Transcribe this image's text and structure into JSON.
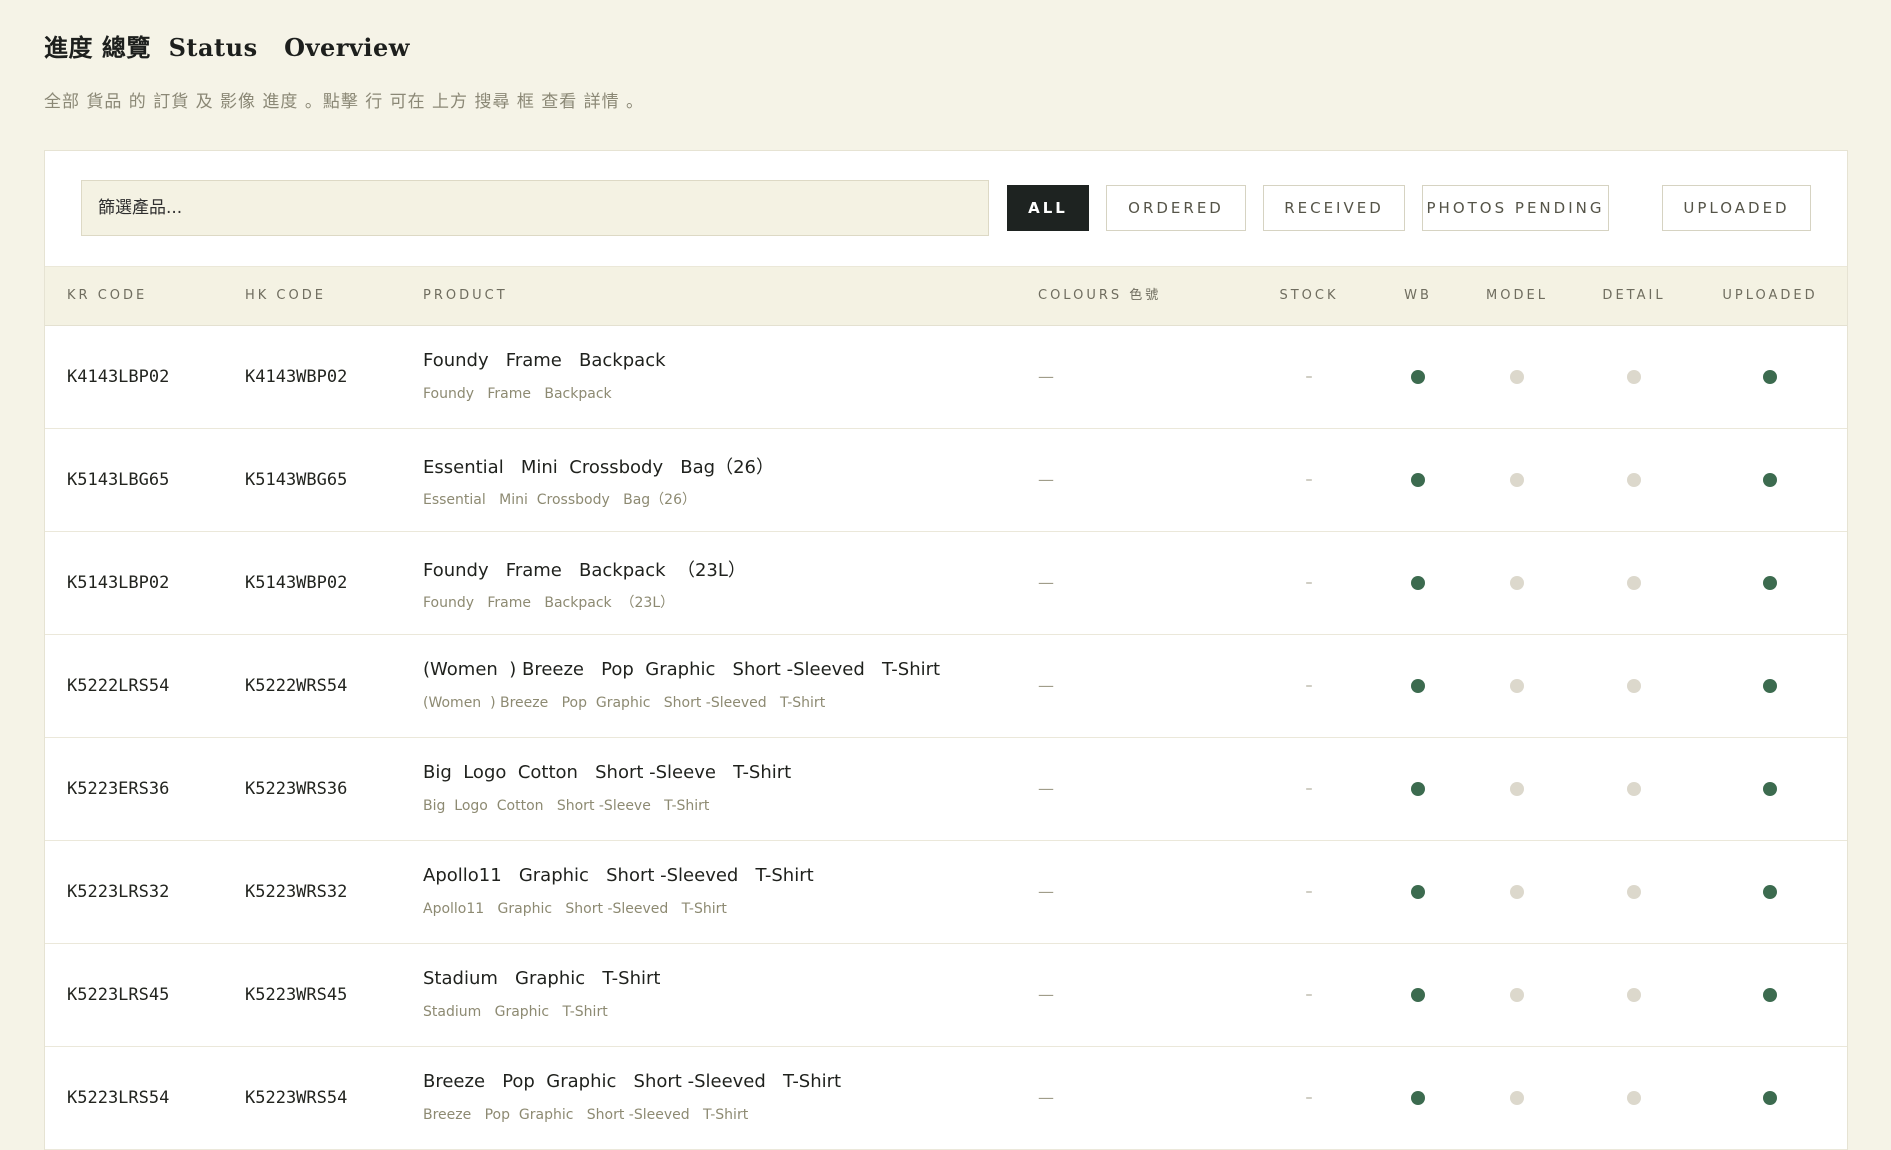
{
  "header": {
    "title": "進度 總覽  Status   Overview",
    "subtitle": "全部 貨品 的 訂貨 及 影像 進度 。點擊 行 可在 上方 搜尋 框 查看 詳情 。"
  },
  "toolbar": {
    "search_placeholder": "篩選產品...",
    "filters": [
      {
        "label": "ALL",
        "active": true
      },
      {
        "label": "ORDERED",
        "active": false
      },
      {
        "label": "RECEIVED",
        "active": false
      },
      {
        "label": "PHOTOS PENDING",
        "active": false
      },
      {
        "label": "UPLOADED",
        "active": false
      }
    ]
  },
  "table": {
    "columns": [
      "KR CODE",
      "HK CODE",
      "PRODUCT",
      "COLOURS 色號",
      "STOCK",
      "WB",
      "MODEL",
      "DETAIL",
      "UPLOADED"
    ],
    "rows": [
      {
        "kr": "K4143LBP02",
        "hk": "K4143WBP02",
        "name": "Foundy   Frame   Backpack",
        "sub": "Foundy   Frame   Backpack",
        "colours": "—",
        "stock": "–",
        "wb": true,
        "model": false,
        "detail": false,
        "uploaded": true
      },
      {
        "kr": "K5143LBG65",
        "hk": "K5143WBG65",
        "name": "Essential   Mini  Crossbody   Bag（26）",
        "sub": "Essential   Mini  Crossbody   Bag（26）",
        "colours": "—",
        "stock": "–",
        "wb": true,
        "model": false,
        "detail": false,
        "uploaded": true
      },
      {
        "kr": "K5143LBP02",
        "hk": "K5143WBP02",
        "name": "Foundy   Frame   Backpack  （23L）",
        "sub": "Foundy   Frame   Backpack  （23L）",
        "colours": "—",
        "stock": "–",
        "wb": true,
        "model": false,
        "detail": false,
        "uploaded": true
      },
      {
        "kr": "K5222LRS54",
        "hk": "K5222WRS54",
        "name": "(Women  ) Breeze   Pop  Graphic   Short -Sleeved   T-Shirt",
        "sub": "(Women  ) Breeze   Pop  Graphic   Short -Sleeved   T-Shirt",
        "colours": "—",
        "stock": "–",
        "wb": true,
        "model": false,
        "detail": false,
        "uploaded": true
      },
      {
        "kr": "K5223ERS36",
        "hk": "K5223WRS36",
        "name": "Big  Logo  Cotton   Short -Sleeve   T-Shirt",
        "sub": "Big  Logo  Cotton   Short -Sleeve   T-Shirt",
        "colours": "—",
        "stock": "–",
        "wb": true,
        "model": false,
        "detail": false,
        "uploaded": true
      },
      {
        "kr": "K5223LRS32",
        "hk": "K5223WRS32",
        "name": "Apollo11   Graphic   Short -Sleeved   T-Shirt",
        "sub": "Apollo11   Graphic   Short -Sleeved   T-Shirt",
        "colours": "—",
        "stock": "–",
        "wb": true,
        "model": false,
        "detail": false,
        "uploaded": true
      },
      {
        "kr": "K5223LRS45",
        "hk": "K5223WRS45",
        "name": "Stadium   Graphic   T-Shirt",
        "sub": "Stadium   Graphic   T-Shirt",
        "colours": "—",
        "stock": "–",
        "wb": true,
        "model": false,
        "detail": false,
        "uploaded": true
      },
      {
        "kr": "K5223LRS54",
        "hk": "K5223WRS54",
        "name": "Breeze   Pop  Graphic   Short -Sleeved   T-Shirt",
        "sub": "Breeze   Pop  Graphic   Short -Sleeved   T-Shirt",
        "colours": "—",
        "stock": "–",
        "wb": true,
        "model": false,
        "detail": false,
        "uploaded": true
      }
    ]
  },
  "colors": {
    "dot_on": "#3c6b4f",
    "dot_off": "#dcd8cc"
  }
}
